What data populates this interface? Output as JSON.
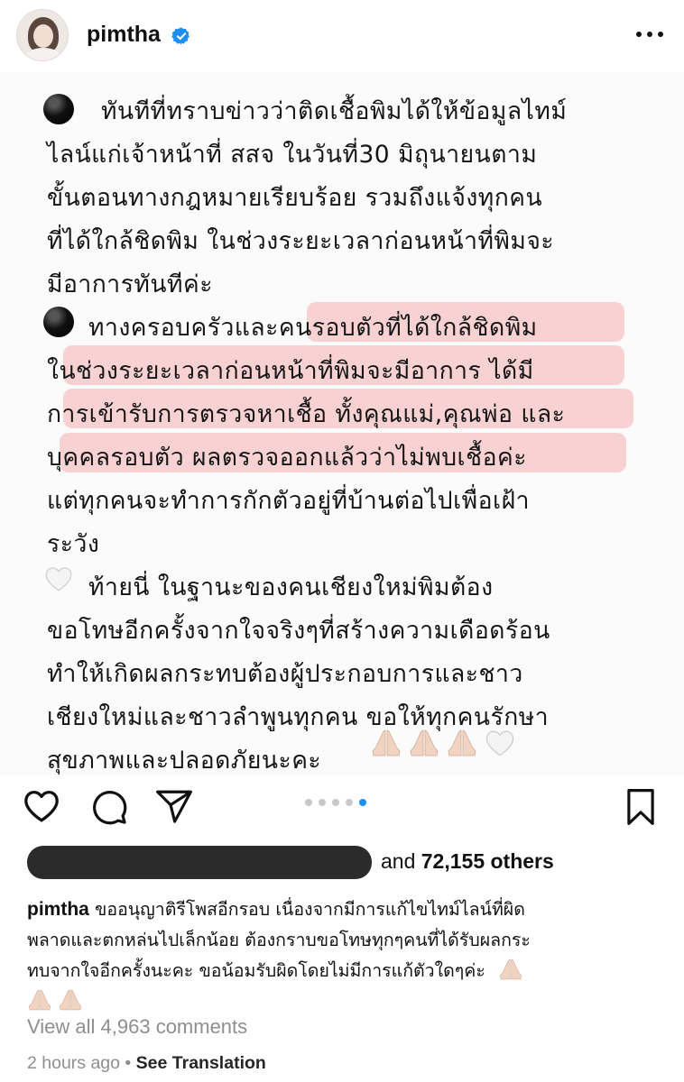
{
  "header": {
    "username": "pimtha",
    "verified": true,
    "more_icon": "more-horizontal-icon"
  },
  "post": {
    "paragraphs": [
      {
        "bullet": "black-circle",
        "lines": [
          "ทันทีที่ทราบข่าวว่าติดเชื้อพิมได้ให้ข้อมูลไทม์",
          "ไลน์แก่เจ้าหน้าที่ สสจ ในวันที่30 มิถุนายนตาม",
          "ขั้นตอนทางกฎหมายเรียบร้อย รวมถึงแจ้งทุกคน",
          "ที่ได้ใกล้ชิดพิม ในช่วงระยะเวลาก่อนหน้าที่พิมจะ",
          "มีอาการทันทีค่ะ"
        ]
      },
      {
        "bullet": "black-circle",
        "lines": [
          "ทางครอบครัวและคนรอบตัวที่ได้ใกล้ชิดพิม",
          "ในช่วงระยะเวลาก่อนหน้าที่พิมจะมีอาการ ได้มี",
          "การเข้ารับการตรวจหาเชื้อ ทั้งคุณแม่,คุณพ่อ และ",
          "บุคคลรอบตัว ผลตรวจออกแล้วว่าไม่พบเชื้อค่ะ",
          "แต่ทุกคนจะทำการกักตัวอยู่ที่บ้านต่อไปเพื่อเฝ้า",
          "ระวัง"
        ]
      },
      {
        "bullet": "white-heart",
        "lines": [
          "ท้ายนี่ ในฐานะของคนเชียงใหม่พิมต้อง",
          "ขอโทษอีกครั้งจากใจจริงๆที่สร้างความเดือดร้อน",
          "ทำให้เกิดผลกระทบต้องผู้ประกอบการและชาว",
          "เชียงใหม่และชาวลำพูนทุกคน ขอให้ทุกคนรักษา",
          "สุขภาพและปลอดภัยนะคะ"
        ]
      }
    ],
    "highlight_color": "#f4a0a0",
    "end_emojis": [
      "folded-hands-icon",
      "folded-hands-icon",
      "folded-hands-icon",
      "white-heart-icon"
    ]
  },
  "actions": {
    "icons": [
      "heart-icon",
      "comment-icon",
      "share-icon",
      "bookmark-icon"
    ],
    "carousel": {
      "count": 5,
      "active_index": 4
    }
  },
  "likes": {
    "suffix_prefix": "and",
    "count_text": "72,155 others"
  },
  "caption": {
    "username": "pimtha",
    "lines": [
      "ขออนุญาติรีโพสอีกรอบ เนื่องจากมีการแก้ไขไทม์ไลน์ที่ผิด",
      "พลาดและตกหล่นไปเล็กน้อย ต้องกราบขอโทษทุกๆคนที่ได้รับผลกระ",
      "ทบจากใจอีกครั้งนะคะ ขอน้อมรับผิดโดยไม่มีการแก้ตัวใดๆค่ะ"
    ],
    "emojis": [
      "folded-hands-icon",
      "folded-hands-icon",
      "folded-hands-icon"
    ]
  },
  "comments_link": "View all 4,963 comments",
  "meta": {
    "time": "2 hours ago",
    "separator": "•",
    "translate": "See Translation"
  },
  "colors": {
    "verified_blue": "#1d8ff5",
    "muted": "#8e8e8e",
    "text": "#111111"
  }
}
